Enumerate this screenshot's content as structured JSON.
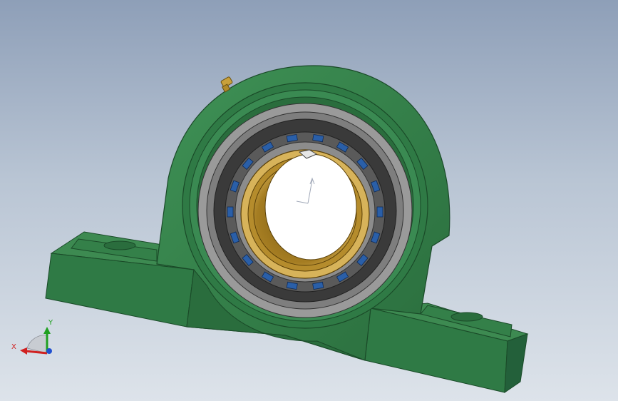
{
  "viewport": {
    "background_top": "#8e9fb8",
    "background_bottom": "#dde3ea"
  },
  "model": {
    "housing_color": "#2f7a45",
    "housing_dark": "#1f5a31",
    "housing_light": "#3f9256",
    "outer_race_color": "#8a8a8a",
    "cage_color": "#3a3a3a",
    "roller_color": "#2a5fa8",
    "insert_color": "#c9a24a",
    "grease_fitting_color": "#c8a03a"
  },
  "triad": {
    "x_label": "X",
    "y_label": "Y",
    "x_color": "#d02020",
    "y_color": "#20a020",
    "z_color": "#2050d0"
  }
}
